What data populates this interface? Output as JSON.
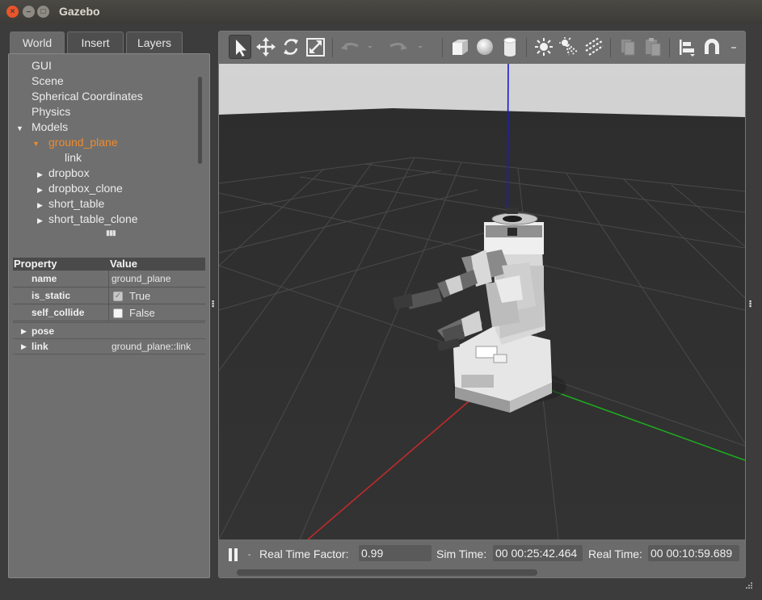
{
  "window": {
    "title": "Gazebo"
  },
  "left_panel": {
    "tabs": [
      "World",
      "Insert",
      "Layers"
    ],
    "tree": [
      {
        "label": "GUI",
        "arrow": "",
        "indent": 0
      },
      {
        "label": "Scene",
        "arrow": "",
        "indent": 0
      },
      {
        "label": "Spherical Coordinates",
        "arrow": "",
        "indent": 0
      },
      {
        "label": "Physics",
        "arrow": "",
        "indent": 0
      },
      {
        "label": "Models",
        "arrow": "▼",
        "indent": 0
      },
      {
        "label": "ground_plane",
        "arrow": "▼",
        "indent": 1
      },
      {
        "label": "link",
        "arrow": "",
        "indent": 2
      },
      {
        "label": "dropbox",
        "arrow": "▶",
        "indent": 1
      },
      {
        "label": "dropbox_clone",
        "arrow": "▶",
        "indent": 1
      },
      {
        "label": "short_table",
        "arrow": "▶",
        "indent": 1
      },
      {
        "label": "short_table_clone",
        "arrow": "▶",
        "indent": 1
      }
    ],
    "properties": {
      "header_property": "Property",
      "header_value": "Value",
      "rows": {
        "name": {
          "key": "name",
          "value": "ground_plane"
        },
        "is_static": {
          "key": "is_static",
          "value": "True",
          "checked": true
        },
        "self_collide": {
          "key": "self_collide",
          "value": "False",
          "checked": false
        },
        "pose": {
          "key": "pose",
          "value": ""
        },
        "link": {
          "key": "link",
          "value": "ground_plane::link"
        }
      }
    }
  },
  "toolbar": {
    "tools": [
      "select-arrow-icon",
      "translate-icon",
      "rotate-icon",
      "scale-icon",
      "undo-icon",
      "redo-icon",
      "box-icon",
      "sphere-icon",
      "cylinder-icon",
      "point-light-icon",
      "spot-light-icon",
      "directional-light-icon",
      "copy-icon",
      "paste-icon",
      "align-icon",
      "snap-magnet-icon"
    ]
  },
  "bottom_bar": {
    "real_time_factor_label": "Real Time Factor:",
    "real_time_factor": "0.99",
    "sim_time_label": "Sim Time:",
    "sim_time": "00 00:25:42.464",
    "real_time_label": "Real Time:",
    "real_time": "00 00:10:59.689"
  },
  "colors": {
    "selection": "#f08a2b",
    "x_axis": "#c02a2a",
    "y_axis": "#1fa81f",
    "z_axis": "#1a1ad0"
  }
}
